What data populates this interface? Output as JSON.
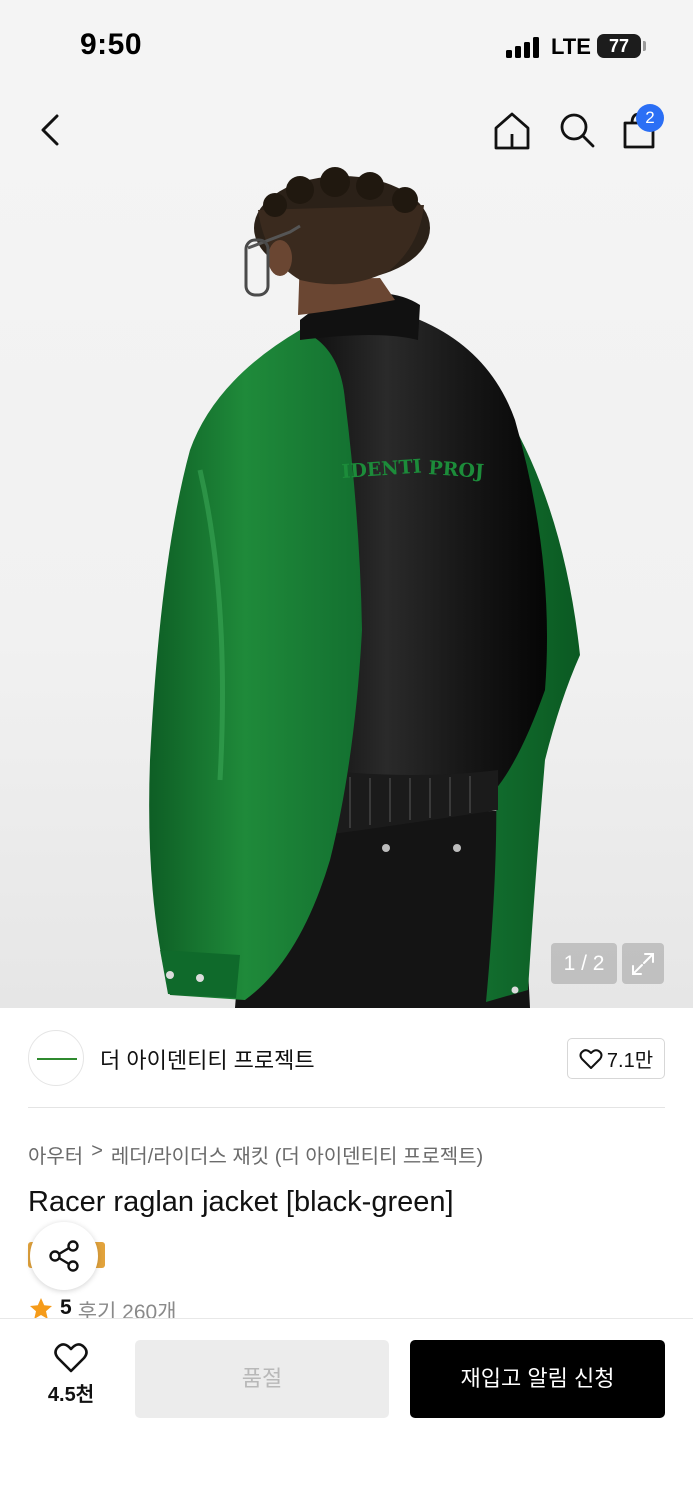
{
  "status_bar": {
    "time": "9:50",
    "network": "LTE",
    "battery": "77"
  },
  "header": {
    "cart_count": "2"
  },
  "gallery": {
    "counter": "1 / 2",
    "print_text_left": "IDENTI",
    "print_text_right": "PROJ"
  },
  "brand": {
    "name": "더 아이덴티티 프로젝트",
    "likes": "7.1만"
  },
  "breadcrumb": {
    "category": "아우터",
    "separator": ">",
    "subcategory": "레더/라이더스 재킷 (더 아이덴티티 프로젝트)"
  },
  "product": {
    "title": "Racer raglan jacket [black-green]",
    "rating": "5",
    "reviews": "후기 260개"
  },
  "bottom_bar": {
    "wish_count": "4.5천",
    "soldout_label": "품절",
    "restock_label": "재입고 알림 신청"
  },
  "colors": {
    "accent_blue": "#2b6ff5",
    "rating_star": "#f59b1a",
    "jacket_green": "#1f8a3a",
    "primary_button": "#000000"
  }
}
